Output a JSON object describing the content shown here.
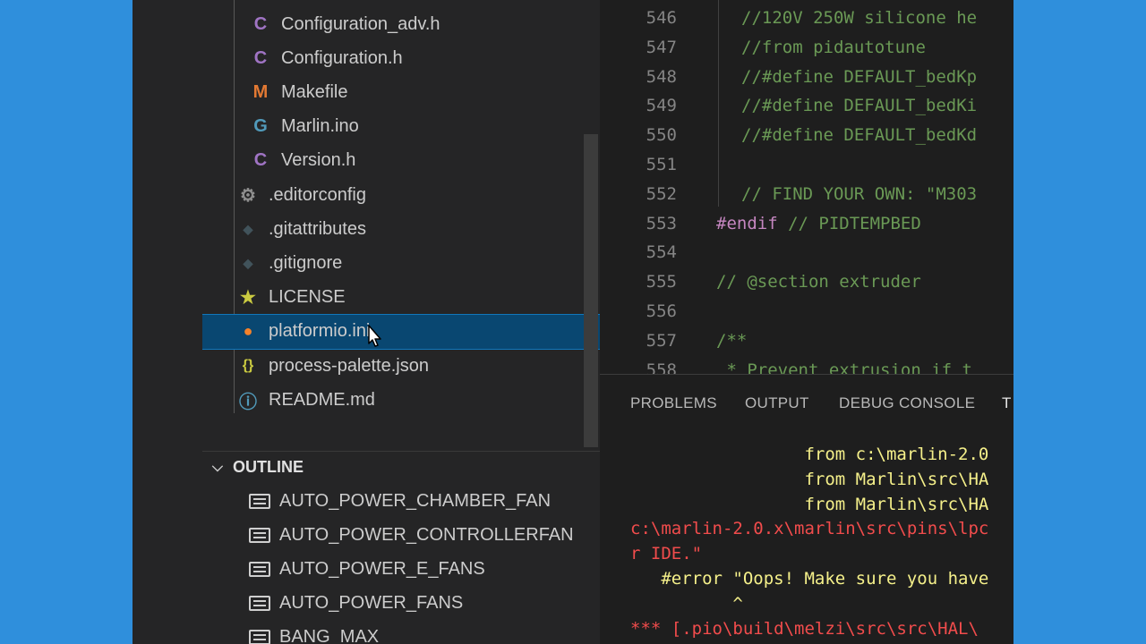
{
  "explorer": {
    "files": [
      {
        "name": "Configuration_adv.h",
        "icon": "C",
        "color": "#a074c4",
        "indent": 1
      },
      {
        "name": "Configuration.h",
        "icon": "C",
        "color": "#a074c4",
        "indent": 1
      },
      {
        "name": "Makefile",
        "icon": "M",
        "color": "#e37933",
        "indent": 1
      },
      {
        "name": "Marlin.ino",
        "icon": "G",
        "color": "#519aba",
        "indent": 1
      },
      {
        "name": "Version.h",
        "icon": "C",
        "color": "#a074c4",
        "indent": 1
      },
      {
        "name": ".editorconfig",
        "icon": "⚙",
        "color": "#8e8e8e",
        "indent": 0
      },
      {
        "name": ".gitattributes",
        "icon": "◆",
        "color": "#41535b",
        "indent": 0
      },
      {
        "name": ".gitignore",
        "icon": "◆",
        "color": "#41535b",
        "indent": 0
      },
      {
        "name": "LICENSE",
        "icon": "★",
        "color": "#cbcb41",
        "indent": 0
      },
      {
        "name": "platformio.ini",
        "icon": "●",
        "color": "#f5822a",
        "indent": 0,
        "selected": true
      },
      {
        "name": "process-palette.json",
        "icon": "{}",
        "color": "#cbcb41",
        "indent": 0
      },
      {
        "name": "README.md",
        "icon": "ⓘ",
        "color": "#519aba",
        "indent": 0
      }
    ]
  },
  "outline": {
    "title": "OUTLINE",
    "items": [
      "AUTO_POWER_CHAMBER_FAN",
      "AUTO_POWER_CONTROLLERFAN",
      "AUTO_POWER_E_FANS",
      "AUTO_POWER_FANS",
      "BANG_MAX"
    ]
  },
  "editor": {
    "lines": [
      {
        "num": "546",
        "text": "//120V 250W silicone he",
        "kind": "comment",
        "indent": true
      },
      {
        "num": "547",
        "text": "//from pidautotune",
        "kind": "comment",
        "indent": true
      },
      {
        "num": "548",
        "text": "//#define DEFAULT_bedKp",
        "kind": "comment",
        "indent": true
      },
      {
        "num": "549",
        "text": "//#define DEFAULT_bedKi",
        "kind": "comment",
        "indent": true
      },
      {
        "num": "550",
        "text": "//#define DEFAULT_bedKd",
        "kind": "comment",
        "indent": true
      },
      {
        "num": "551",
        "text": "",
        "kind": "comment",
        "indent": true
      },
      {
        "num": "552",
        "text": "// FIND YOUR OWN: \"M303",
        "kind": "comment",
        "indent": true
      },
      {
        "num": "553",
        "text": "#endif",
        "rest": " // PIDTEMPBED",
        "kind": "pp",
        "indent": false
      },
      {
        "num": "554",
        "text": "",
        "kind": "comment",
        "indent": false
      },
      {
        "num": "555",
        "text": "// @section extruder",
        "kind": "comment",
        "indent": false
      },
      {
        "num": "556",
        "text": "",
        "kind": "comment",
        "indent": false
      },
      {
        "num": "557",
        "text": "/**",
        "kind": "comment",
        "indent": false
      },
      {
        "num": "558",
        "text": " * Prevent extrusion if t",
        "kind": "comment",
        "indent": false
      }
    ]
  },
  "panel": {
    "tabs": [
      "PROBLEMS",
      "OUTPUT",
      "DEBUG CONSOLE",
      "T"
    ],
    "terminal": [
      {
        "text": "                 from c:\\marlin-2.0",
        "color": "yellow"
      },
      {
        "text": "                 from Marlin\\src\\HA",
        "color": "yellow"
      },
      {
        "text": "                 from Marlin\\src\\HA",
        "color": "yellow"
      },
      {
        "text": "c:\\marlin-2.0.x\\marlin\\src\\pins\\lpc",
        "color": "red"
      },
      {
        "text": "r IDE.\"",
        "color": "red"
      },
      {
        "text": "   #error \"Oops! Make sure you have",
        "color": "yellow"
      },
      {
        "text": "          ^",
        "color": "yellow"
      },
      {
        "text": "*** [.pio\\build\\melzi\\src\\src\\HAL\\",
        "color": "red"
      }
    ]
  }
}
